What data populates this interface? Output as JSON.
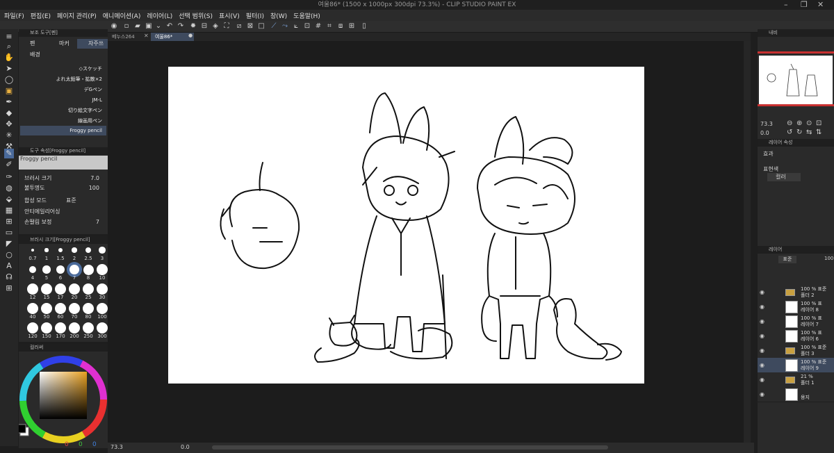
{
  "titlebar": {
    "title": "여울86* (1500 x 1000px 300dpi 73.3%)  - CLIP STUDIO PAINT EX"
  },
  "menu": [
    "파일(F)",
    "편집(E)",
    "페이지 관리(P)",
    "애니메이션(A)",
    "레이어(L)",
    "선택 범위(S)",
    "표시(V)",
    "필터(I)",
    "창(W)",
    "도움말(H)"
  ],
  "tabs": [
    {
      "label": "베누스264"
    },
    {
      "label": "여울86*"
    }
  ],
  "subtool": {
    "header": "보조 도구[펜]",
    "tabs": [
      "펜",
      "마커",
      "자주쓰"
    ],
    "group": "배경",
    "brushes": [
      "◇スケッチ",
      "よれ太鉛筆・拡散×2",
      "デGペン",
      "JM-L",
      "切り絵文字ペン",
      "線画用ペン",
      "Froggy pencil"
    ]
  },
  "toolprop": {
    "header": "도구 속성[Froggy pencil]",
    "brush_name": "Froggy pencil",
    "size_label": "브러시 크기",
    "size_value": "7.0",
    "opacity_label": "불투명도",
    "opacity_value": "100",
    "blend_label": "합성 모드",
    "blend_value": "표준",
    "aa_label": "안티에일리어싱",
    "stab_label": "손떨림 보정",
    "stab_value": "7"
  },
  "brushsize": {
    "header": "브러시 크기[Froggy pencil]",
    "sizes": [
      "0.7",
      "1",
      "1.5",
      "2",
      "2.5",
      "3",
      "4",
      "5",
      "6",
      "7",
      "8",
      "10",
      "12",
      "15",
      "17",
      "20",
      "25",
      "30",
      "40",
      "50",
      "60",
      "70",
      "80",
      "100",
      "120",
      "150",
      "170",
      "200",
      "250",
      "300"
    ]
  },
  "colorwheel": {
    "header": "컬러써",
    "fg": "#000000",
    "bg": "#ffffff",
    "vals": [
      "0",
      "0",
      "0"
    ]
  },
  "navigator": {
    "header": "내비",
    "zoom": "73.3",
    "rotate": "0.0"
  },
  "layerprop": {
    "header": "레이어 속성",
    "effect_label": "효과",
    "color_label": "표현색",
    "color_value": "컬러"
  },
  "layers": {
    "header": "레이어",
    "blend": "표준",
    "opacity": "100",
    "items": [
      {
        "line1": "100 % 표준",
        "line2": "폴더 2",
        "kind": "folder"
      },
      {
        "line1": "100 % 표",
        "line2": "레이어 8",
        "kind": "layer"
      },
      {
        "line1": "100 % 표",
        "line2": "레이어 7",
        "kind": "layer"
      },
      {
        "line1": "100 % 표",
        "line2": "레이어 6",
        "kind": "layer"
      },
      {
        "line1": "100 % 표준",
        "line2": "폴더 3",
        "kind": "folder"
      },
      {
        "line1": "100 % 표준",
        "line2": "레이어 9",
        "kind": "layer",
        "selected": true
      },
      {
        "line1": "21 %",
        "line2": "폴더 1",
        "kind": "folder"
      },
      {
        "line1": "",
        "line2": "용지",
        "kind": "paper"
      }
    ]
  },
  "status": {
    "zoom": "73.3",
    "angle": "0.0"
  }
}
